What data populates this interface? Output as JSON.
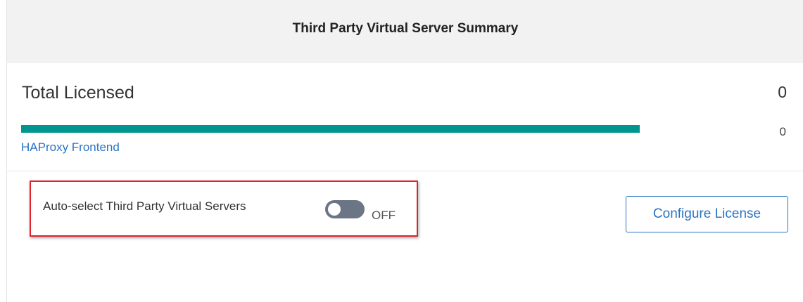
{
  "panel": {
    "title": "Third Party Virtual Server Summary"
  },
  "summary": {
    "total_label": "Total Licensed",
    "total_count": "0",
    "bar": {
      "label": "HAProxy Frontend",
      "count": "0",
      "fill_fraction": 1.0,
      "color": "#00968f"
    }
  },
  "auto_select": {
    "label": "Auto-select Third Party Virtual Servers",
    "state": "OFF",
    "enabled": false
  },
  "actions": {
    "configure_label": "Configure License"
  },
  "colors": {
    "accent_blue": "#2a73c2",
    "highlight_red": "#e0232b",
    "toggle_off": "#6b7585"
  }
}
